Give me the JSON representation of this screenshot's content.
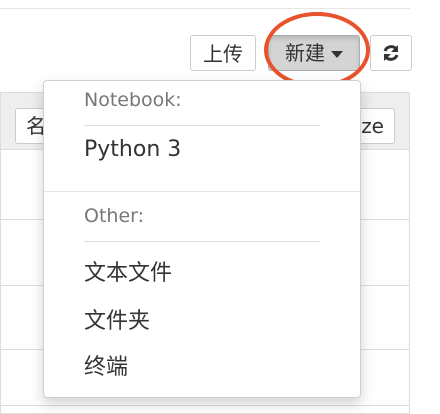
{
  "toolbar": {
    "upload_label": "上传",
    "new_label": "新建",
    "refresh_icon": "refresh-icon"
  },
  "list_header": {
    "name_label": "名",
    "size_label": "ze"
  },
  "new_menu": {
    "notebook_header": "Notebook:",
    "notebook_items": [
      "Python 3"
    ],
    "other_header": "Other:",
    "other_items": [
      "文本文件",
      "文件夹",
      "终端"
    ]
  },
  "colors": {
    "highlight_ring": "#e8522c",
    "pressed_button": "#d4d4d4"
  }
}
